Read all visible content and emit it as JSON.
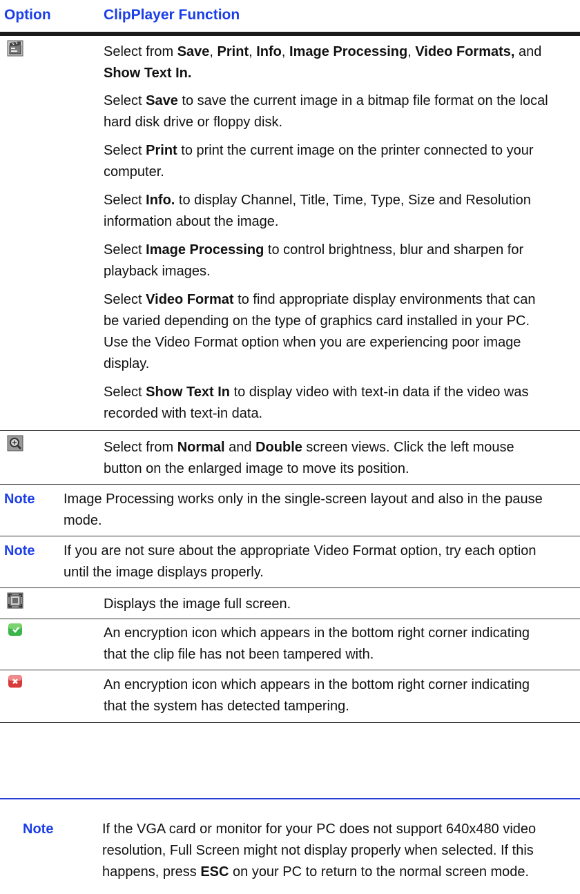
{
  "header": {
    "option_label": "Option",
    "function_label": "ClipPlayer Function"
  },
  "row_menu": {
    "icon": "clapboard-menu-icon",
    "intro": {
      "t1": "Select from ",
      "b1": "Save",
      "t2": ", ",
      "b2": "Print",
      "t3": ", ",
      "b3": "Info",
      "t4": ", ",
      "b4": "Image Processing",
      "t5": ", ",
      "b5": "Video Formats,",
      "t6": " and ",
      "b6": "Show Text In."
    },
    "save": {
      "t1": "Select ",
      "b1": "Save",
      "t2": " to save the current image in a bitmap file format on the local hard disk drive or floppy disk."
    },
    "print": {
      "t1": "Select ",
      "b1": "Print",
      "t2": " to print the current image on the printer connected to your computer."
    },
    "info": {
      "t1": "Select ",
      "b1": "Info.",
      "t2": " to display Channel, Title, Time, Type, Size and Resolution information about the image."
    },
    "imgproc": {
      "t1": "Select ",
      "b1": "Image Processing",
      "t2": " to control brightness, blur and sharpen for playback images."
    },
    "videofmt": {
      "t1": "Select ",
      "b1": "Video Format",
      "t2": " to find appropriate display environments that can be varied depending on the type of graphics card installed in your PC. Use the Video Format option when you are experiencing poor image display."
    },
    "showtext": {
      "t1": "Select ",
      "b1": "Show Text In",
      "t2": " to display video with text-in data if the video was recorded with text-in data."
    }
  },
  "row_zoom": {
    "icon": "zoom-magnifier-icon",
    "text": {
      "t1": "Select from ",
      "b1": "Normal",
      "t2": " and ",
      "b2": "Double",
      "t3": " screen views. Click the left mouse button on the enlarged image to move its position."
    }
  },
  "note1": {
    "label": "Note",
    "text": "Image Processing works only in the single-screen layout and also in the pause mode."
  },
  "note2": {
    "label": "Note",
    "text": "If you are not sure about the appropriate Video Format option, try each option until the image displays properly."
  },
  "row_fullscreen": {
    "icon": "fullscreen-icon",
    "text": "Displays the image full screen."
  },
  "row_encrypt_ok": {
    "icon": "encryption-ok-icon",
    "text": "An encryption icon which appears in the bottom right corner indicating that the clip file has not been tampered with."
  },
  "row_encrypt_bad": {
    "icon": "encryption-tampered-icon",
    "text": "An encryption icon which appears in the bottom right corner indicating that the system has detected tampering."
  },
  "bottom_note": {
    "label": "Note",
    "t1": "If the VGA card or monitor for your PC does not support 640x480 video resolution, Full Screen might not display properly when selected. If this happens, press ",
    "b1": "ESC",
    "t2": " on your PC to return to the normal screen mode."
  },
  "colors": {
    "accent_blue": "#1a3ee8",
    "rule_dark": "#1a1a1a",
    "rule_blue": "#2a3fd9",
    "ok_green": "#3bb54a",
    "bad_red": "#d93a3a"
  }
}
